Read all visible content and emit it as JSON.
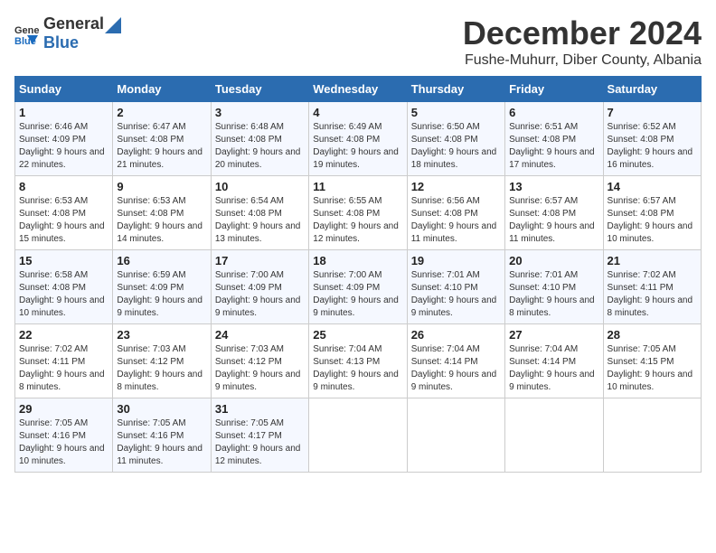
{
  "logo": {
    "general": "General",
    "blue": "Blue"
  },
  "title": "December 2024",
  "subtitle": "Fushe-Muhurr, Diber County, Albania",
  "weekdays": [
    "Sunday",
    "Monday",
    "Tuesday",
    "Wednesday",
    "Thursday",
    "Friday",
    "Saturday"
  ],
  "weeks": [
    [
      {
        "day": "1",
        "sunrise": "6:46 AM",
        "sunset": "4:09 PM",
        "daylight": "9 hours and 22 minutes."
      },
      {
        "day": "2",
        "sunrise": "6:47 AM",
        "sunset": "4:08 PM",
        "daylight": "9 hours and 21 minutes."
      },
      {
        "day": "3",
        "sunrise": "6:48 AM",
        "sunset": "4:08 PM",
        "daylight": "9 hours and 20 minutes."
      },
      {
        "day": "4",
        "sunrise": "6:49 AM",
        "sunset": "4:08 PM",
        "daylight": "9 hours and 19 minutes."
      },
      {
        "day": "5",
        "sunrise": "6:50 AM",
        "sunset": "4:08 PM",
        "daylight": "9 hours and 18 minutes."
      },
      {
        "day": "6",
        "sunrise": "6:51 AM",
        "sunset": "4:08 PM",
        "daylight": "9 hours and 17 minutes."
      },
      {
        "day": "7",
        "sunrise": "6:52 AM",
        "sunset": "4:08 PM",
        "daylight": "9 hours and 16 minutes."
      }
    ],
    [
      {
        "day": "8",
        "sunrise": "6:53 AM",
        "sunset": "4:08 PM",
        "daylight": "9 hours and 15 minutes."
      },
      {
        "day": "9",
        "sunrise": "6:53 AM",
        "sunset": "4:08 PM",
        "daylight": "9 hours and 14 minutes."
      },
      {
        "day": "10",
        "sunrise": "6:54 AM",
        "sunset": "4:08 PM",
        "daylight": "9 hours and 13 minutes."
      },
      {
        "day": "11",
        "sunrise": "6:55 AM",
        "sunset": "4:08 PM",
        "daylight": "9 hours and 12 minutes."
      },
      {
        "day": "12",
        "sunrise": "6:56 AM",
        "sunset": "4:08 PM",
        "daylight": "9 hours and 11 minutes."
      },
      {
        "day": "13",
        "sunrise": "6:57 AM",
        "sunset": "4:08 PM",
        "daylight": "9 hours and 11 minutes."
      },
      {
        "day": "14",
        "sunrise": "6:57 AM",
        "sunset": "4:08 PM",
        "daylight": "9 hours and 10 minutes."
      }
    ],
    [
      {
        "day": "15",
        "sunrise": "6:58 AM",
        "sunset": "4:08 PM",
        "daylight": "9 hours and 10 minutes."
      },
      {
        "day": "16",
        "sunrise": "6:59 AM",
        "sunset": "4:09 PM",
        "daylight": "9 hours and 9 minutes."
      },
      {
        "day": "17",
        "sunrise": "7:00 AM",
        "sunset": "4:09 PM",
        "daylight": "9 hours and 9 minutes."
      },
      {
        "day": "18",
        "sunrise": "7:00 AM",
        "sunset": "4:09 PM",
        "daylight": "9 hours and 9 minutes."
      },
      {
        "day": "19",
        "sunrise": "7:01 AM",
        "sunset": "4:10 PM",
        "daylight": "9 hours and 9 minutes."
      },
      {
        "day": "20",
        "sunrise": "7:01 AM",
        "sunset": "4:10 PM",
        "daylight": "9 hours and 8 minutes."
      },
      {
        "day": "21",
        "sunrise": "7:02 AM",
        "sunset": "4:11 PM",
        "daylight": "9 hours and 8 minutes."
      }
    ],
    [
      {
        "day": "22",
        "sunrise": "7:02 AM",
        "sunset": "4:11 PM",
        "daylight": "9 hours and 8 minutes."
      },
      {
        "day": "23",
        "sunrise": "7:03 AM",
        "sunset": "4:12 PM",
        "daylight": "9 hours and 8 minutes."
      },
      {
        "day": "24",
        "sunrise": "7:03 AM",
        "sunset": "4:12 PM",
        "daylight": "9 hours and 9 minutes."
      },
      {
        "day": "25",
        "sunrise": "7:04 AM",
        "sunset": "4:13 PM",
        "daylight": "9 hours and 9 minutes."
      },
      {
        "day": "26",
        "sunrise": "7:04 AM",
        "sunset": "4:14 PM",
        "daylight": "9 hours and 9 minutes."
      },
      {
        "day": "27",
        "sunrise": "7:04 AM",
        "sunset": "4:14 PM",
        "daylight": "9 hours and 9 minutes."
      },
      {
        "day": "28",
        "sunrise": "7:05 AM",
        "sunset": "4:15 PM",
        "daylight": "9 hours and 10 minutes."
      }
    ],
    [
      {
        "day": "29",
        "sunrise": "7:05 AM",
        "sunset": "4:16 PM",
        "daylight": "9 hours and 10 minutes."
      },
      {
        "day": "30",
        "sunrise": "7:05 AM",
        "sunset": "4:16 PM",
        "daylight": "9 hours and 11 minutes."
      },
      {
        "day": "31",
        "sunrise": "7:05 AM",
        "sunset": "4:17 PM",
        "daylight": "9 hours and 12 minutes."
      },
      null,
      null,
      null,
      null
    ]
  ],
  "labels": {
    "sunrise": "Sunrise:",
    "sunset": "Sunset:",
    "daylight": "Daylight:"
  }
}
